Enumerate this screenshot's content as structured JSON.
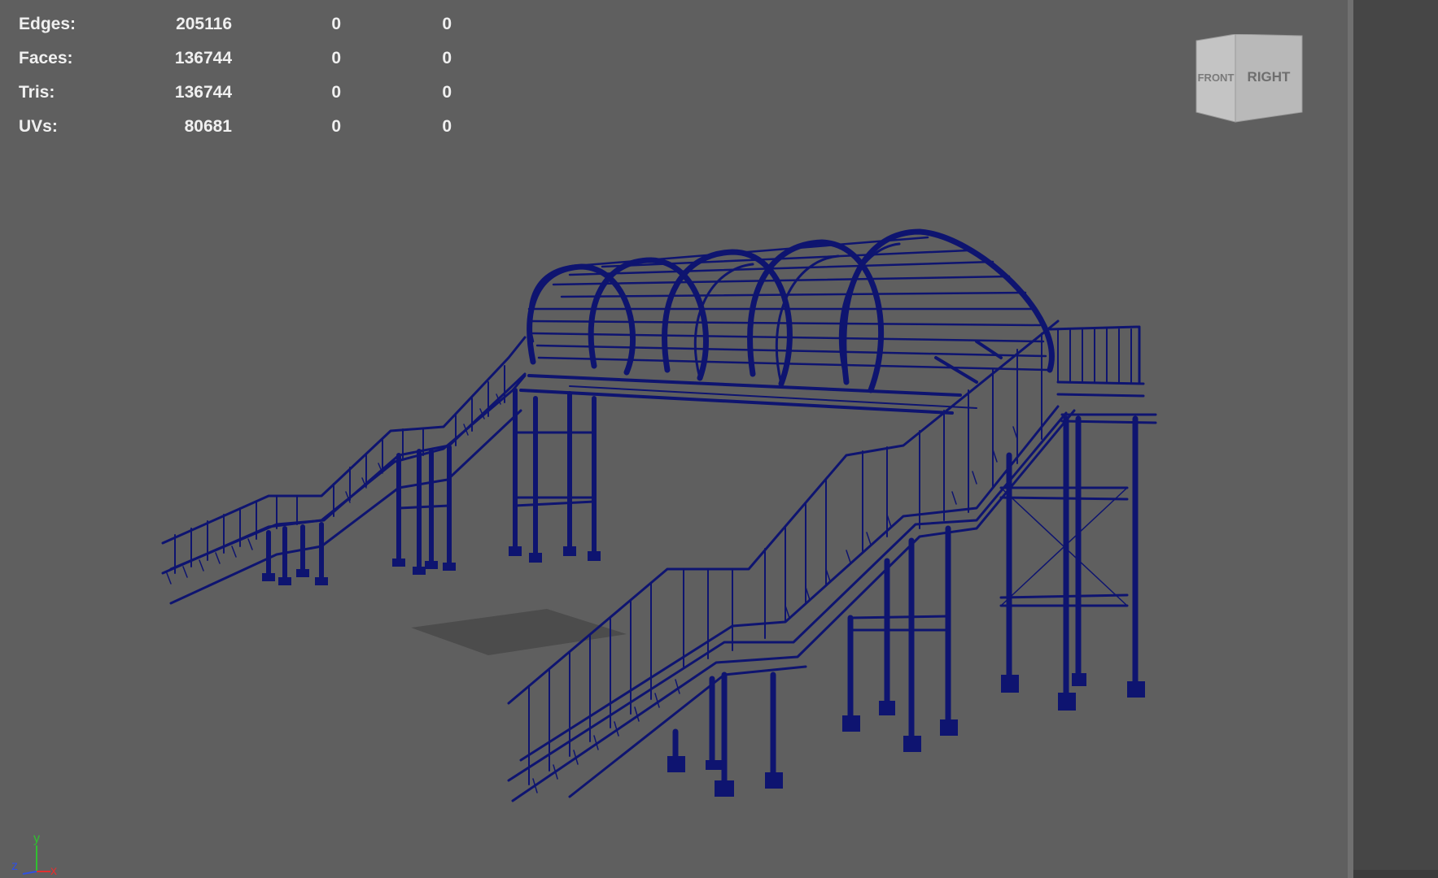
{
  "hud": {
    "rows": [
      {
        "label": "Edges:",
        "v1": "205116",
        "v2": "0",
        "v3": "0"
      },
      {
        "label": "Faces:",
        "v1": "136744",
        "v2": "0",
        "v3": "0"
      },
      {
        "label": "Tris:",
        "v1": "136744",
        "v2": "0",
        "v3": "0"
      },
      {
        "label": "UVs:",
        "v1": "80681",
        "v2": "0",
        "v3": "0"
      }
    ]
  },
  "view_cube": {
    "front_label": "FRONT",
    "right_label": "RIGHT"
  },
  "axis": {
    "x": "x",
    "y": "y",
    "z": "z"
  },
  "colors": {
    "viewport_bg": "#5f5f5f",
    "wireframe": "#0e1470",
    "hud_text": "#f0f0f0",
    "axis_x": "#e03030",
    "axis_y": "#30c030",
    "axis_z": "#3050e0"
  }
}
